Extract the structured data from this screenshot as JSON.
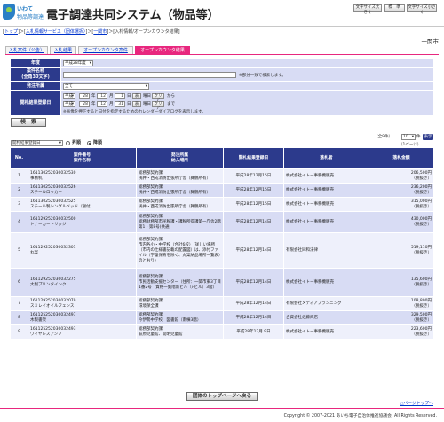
{
  "header": {
    "logo_line1": "いわて",
    "logo_line2": "物品等調達",
    "system_title": "電子調達共同システム（物品等）",
    "font_buttons": [
      "文字サイズ大きく",
      "標　準",
      "文字サイズ小さく"
    ]
  },
  "breadcrumb": {
    "items": [
      "トップ",
      "入札情報サービス（団体選択）",
      "一関市"
    ],
    "current": "入札情報/オープンカウンタ結果"
  },
  "municipality": "一関市",
  "tabs": [
    "入札案件（公告）",
    "入札結果",
    "オープンカウンタ案件",
    "オープンカウンタ結果"
  ],
  "form": {
    "year_label": "年度",
    "year_value": "平成28年度",
    "case_label_line1": "案件名称",
    "case_label_line2": "(全角30文字)",
    "case_note": "※部分一致で検索します。",
    "dept_label": "発注所属",
    "dept_value": "全て",
    "date_label": "開札結果登録日",
    "era": "平成",
    "from": {
      "year": "28",
      "month": "12",
      "day": "1"
    },
    "to": {
      "year": "28",
      "month": "12",
      "day": "31"
    },
    "year_unit": "年",
    "month_unit": "月",
    "day_unit": "日",
    "cal_btn": "表",
    "clear_btn": "クリア",
    "from_text": "から",
    "to_text": "まで",
    "date_note": "※画像を押下すると日付を指定するためのカレンダーダイアログを表示します。",
    "search_btn": "検　索"
  },
  "results": {
    "sort_value": "開札結果登録日",
    "order_asc": "昇順",
    "order_desc": "降順",
    "count_text": "全9件",
    "per_page": "10",
    "per_page_unit": "件",
    "display_btn": "表示",
    "page_info": "（1ページ）",
    "headers": {
      "no": "No.",
      "case_no": "案件番号",
      "case_name": "案件名称",
      "dept": "発注所属",
      "place": "納入場所",
      "date": "開札結果登録日",
      "winner": "落札者",
      "amount": "落札金額"
    },
    "rows": [
      {
        "no": "1",
        "case_no": "161130252030032530",
        "name": "事務机",
        "dept": "総務部契約課",
        "place": "浅井・西成消防出張所庁舎（舞鶴所有）",
        "date": "平成28年12月15日",
        "winner": "株式会社イトー事務機販売",
        "amount": "206,500円",
        "tax": "（税抜き）"
      },
      {
        "no": "2",
        "case_no": "161130252030032526",
        "name": "スチールロッカー",
        "dept": "総務部契約課",
        "place": "浅井・西成消防出張所庁舎（舞鶴所有）",
        "date": "平成28年12月15日",
        "winner": "株式会社イトー事務機販売",
        "amount": "236,200円",
        "tax": "（税抜き）"
      },
      {
        "no": "3",
        "case_no": "161130252030032525",
        "name": "スチール製シングルベッド（寝付）",
        "dept": "総務部契約課",
        "place": "浅井・西成消防出張所庁舎（舞鶴所有）",
        "date": "平成28年12月15日",
        "winner": "株式会社イトー事務機販売",
        "amount": "315,000円",
        "tax": "（税抜き）"
      },
      {
        "no": "4",
        "case_no": "161129252030032500",
        "name": "トナーカートリッジ",
        "dept": "総務部契約課",
        "place": "総務財務部市民税課・課税所得課第一庁舎2階 第1・第8号(共通)",
        "date": "平成28年12月14日",
        "winner": "株式会社イトー事務機販売",
        "amount": "430,000円",
        "tax": "（税抜き）"
      },
      {
        "no": "5",
        "case_no": "161129252030032301",
        "name": "丸案",
        "dept": "総務部契約課",
        "place": "市内各小・中学校（合計6校）（詳しい場所（市内の仕様書記載の配置図）は、添付ファイル（学童保育を除く、丸案納品場所一覧表）のとおり）",
        "date": "平成28年12月14日",
        "winner": "有限会社同和法律",
        "amount": "519,110円",
        "tax": "（税抜き）"
      },
      {
        "no": "6",
        "case_no": "161129252030032275",
        "name": "大判プリンタインク",
        "dept": "総務部契約課",
        "place": "市民活動支援センター（住所：一関市東3丁目1番2号　資格一覧階新ビル（i-ビル）3階）",
        "date": "平成28年12月14日",
        "winner": "株式会社イトー事務機販売",
        "amount": "135,600円",
        "tax": "（税抜き）"
      },
      {
        "no": "7",
        "case_no": "161129252030032079",
        "name": "スミレイオイルフェンス",
        "dept": "総務部契約課",
        "place": "環境保全課",
        "date": "平成28年12月14日",
        "winner": "有限会社メディアプランニング",
        "amount": "108,800円",
        "tax": "（税抜き）"
      },
      {
        "no": "8",
        "case_no": "161125252030032497",
        "name": "木製書架",
        "dept": "総務部契約課",
        "place": "今伊勢中学校　図書館（南棟3階）",
        "date": "平成28年12月14日",
        "winner": "合資会社佐藤商店",
        "amount": "329,500円",
        "tax": "（税抜き）"
      },
      {
        "no": "9",
        "case_no": "161125252030032493",
        "name": "ワイヤレスアンプ",
        "dept": "総務部契約課",
        "place": "萩原児童館、開明児童館",
        "date": "平成28年12月 9日",
        "winner": "株式会社イトー事務機販売",
        "amount": "223,600円",
        "tax": "（税抜き）"
      }
    ]
  },
  "back_btn": "団体のトップページへ戻る",
  "page_top": "△ページトップへ",
  "footer": "Copyright © 2007-2021 あいち電子自治体推進協議会, All Rights Reserved."
}
